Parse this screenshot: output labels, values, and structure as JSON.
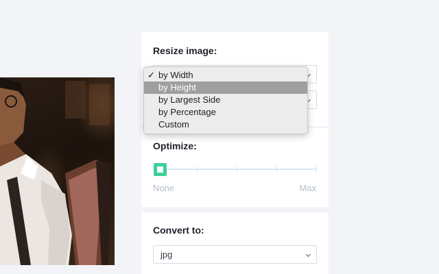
{
  "resize": {
    "title": "Resize image:",
    "options": [
      {
        "label": "by Width",
        "checked": true
      },
      {
        "label": "by Height",
        "highlighted": true
      },
      {
        "label": "by Largest Side"
      },
      {
        "label": "by Percentage"
      },
      {
        "label": "Custom"
      }
    ],
    "check_glyph": "✓"
  },
  "optimize": {
    "title": "Optimize:",
    "min_label": "None",
    "max_label": "Max",
    "level": 0,
    "accent": "#3fcf9a"
  },
  "convert": {
    "title": "Convert to:",
    "value": "jpg"
  },
  "icons": {
    "select_arrow": "chevron-down-icon",
    "checkmark": "checkmark-icon"
  }
}
